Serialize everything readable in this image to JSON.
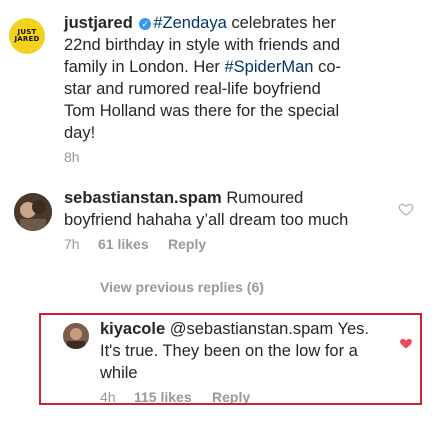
{
  "post": {
    "username": "justjared",
    "avatar_text": [
      "JUST",
      "JARED"
    ],
    "caption_hashtag1": "#Zendaya",
    "caption_part1": " celebrates her",
    "caption_line2": "22nd birthday in style with friends and",
    "caption_line3_a": "family in London. Her ",
    "caption_hashtag2": "#SpiderMan",
    "caption_line3_b": " co-",
    "caption_line4": "star and rumored real-life boyfriend",
    "caption_line5": "Tom Holland was there for the special",
    "caption_line6": "day!",
    "time": "8h"
  },
  "comment": {
    "username": "sebastianstan.spam",
    "text_part1": " Rumoured",
    "text_line2": "boyfriend hahaha y’all dream too much",
    "time": "7h",
    "likes": "61 likes",
    "reply": "Reply"
  },
  "view_previous": "View previous replies (6)",
  "reply": {
    "username": "kiyacole",
    "text_part1": " @sebastianstan.spam Yes.",
    "text_line2": "It's true. They been on the low for a",
    "text_line3": "while",
    "time": "4h",
    "likes": "115 likes",
    "reply": "Reply"
  },
  "colors": {
    "highlight": "#d01f34",
    "liked_heart": "#ed4956",
    "hashtag": "#003569"
  },
  "icons": [
    "verified-badge-icon",
    "heart-outline-icon",
    "heart-filled-icon"
  ]
}
